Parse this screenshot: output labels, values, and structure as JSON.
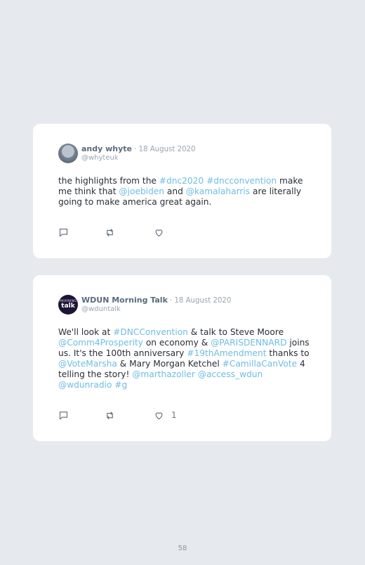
{
  "tweets": [
    {
      "author": "andy whyte",
      "date": "· 18 August 2020",
      "handle": "@whyteuk",
      "body": [
        {
          "text": "the highlights from the ",
          "link": false
        },
        {
          "text": "#dnc2020",
          "link": true
        },
        {
          "text": " ",
          "link": false
        },
        {
          "text": "#dncconvention",
          "link": true
        },
        {
          "text": " make me think that ",
          "link": false
        },
        {
          "text": "@joebiden",
          "link": true
        },
        {
          "text": " and ",
          "link": false
        },
        {
          "text": "@kamalaharris",
          "link": true
        },
        {
          "text": " are literally going to make america great again.",
          "link": false
        }
      ],
      "likes": ""
    },
    {
      "author": "WDUN Morning Talk",
      "date": "· 18 August 2020",
      "handle": "@wduntalk",
      "avatar_text": [
        "MORNING",
        "talk"
      ],
      "body": [
        {
          "text": "We'll look at ",
          "link": false
        },
        {
          "text": "#DNCConvention",
          "link": true
        },
        {
          "text": " & talk to Steve Moore ",
          "link": false
        },
        {
          "text": "@Comm4Prosperity",
          "link": true
        },
        {
          "text": " on economy & ",
          "link": false
        },
        {
          "text": "@PARISDENNARD",
          "link": true
        },
        {
          "text": " joins us. It's the 100th anniversary ",
          "link": false
        },
        {
          "text": "#19thAmendment",
          "link": true
        },
        {
          "text": " thanks to ",
          "link": false
        },
        {
          "text": "@VoteMarsha",
          "link": true
        },
        {
          "text": " & Mary Morgan Ketchel ",
          "link": false
        },
        {
          "text": "#CamillaCanVote",
          "link": true
        },
        {
          "text": " 4 telling the story! ",
          "link": false
        },
        {
          "text": "@marthazoller",
          "link": true
        },
        {
          "text": " ",
          "link": false
        },
        {
          "text": "@access_wdun",
          "link": true
        },
        {
          "text": " ",
          "link": false
        },
        {
          "text": "@wdunradio",
          "link": true
        },
        {
          "text": " ",
          "link": false
        },
        {
          "text": "#g",
          "link": true
        }
      ],
      "likes": "1"
    }
  ],
  "page_number": "58",
  "colors": {
    "background": "#e6e9ed",
    "card": "#ffffff",
    "link": "#6ebde3",
    "name": "#5b6b7e",
    "muted": "#98a4b2"
  },
  "icons": [
    "reply-icon",
    "retweet-icon",
    "like-icon"
  ]
}
